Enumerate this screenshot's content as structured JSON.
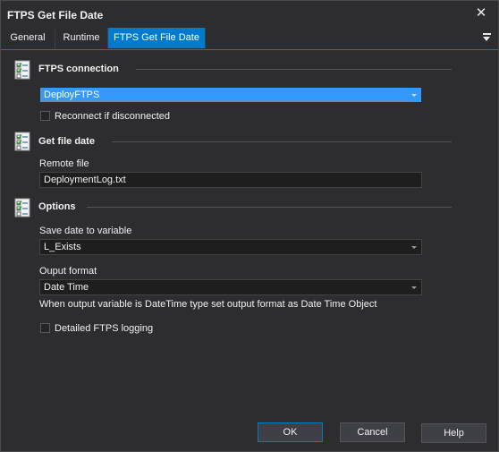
{
  "window": {
    "title": "FTPS Get File Date"
  },
  "tabs": [
    {
      "label": "General"
    },
    {
      "label": "Runtime"
    },
    {
      "label": "FTPS Get File Date"
    }
  ],
  "sections": {
    "connection": {
      "title": "FTPS connection",
      "connection_value": "DeployFTPS",
      "reconnect_label": "Reconnect if disconnected"
    },
    "get_file_date": {
      "title": "Get file date",
      "remote_file_label": "Remote file",
      "remote_file_value": "DeploymentLog.txt"
    },
    "options": {
      "title": "Options",
      "save_date_label": "Save date to variable",
      "save_date_value": "L_Exists",
      "output_format_label": "Ouput format",
      "output_format_value": "Date Time",
      "hint": "When output variable is DateTime type set output format as Date Time Object",
      "detailed_logging_label": "Detailed FTPS logging"
    }
  },
  "buttons": {
    "ok": "OK",
    "cancel": "Cancel",
    "help": "Help"
  },
  "colors": {
    "accent": "#007acc",
    "background": "#2d2d30",
    "selection": "#3399ff"
  }
}
